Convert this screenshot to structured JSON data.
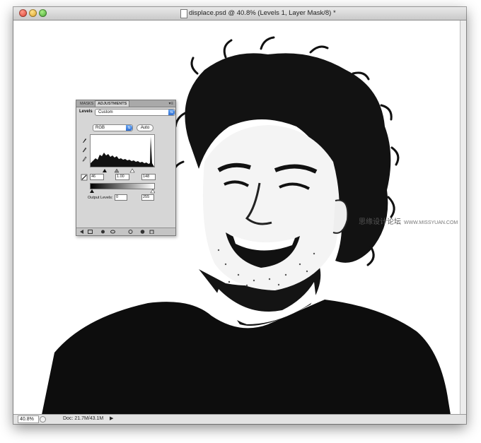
{
  "window": {
    "title": "displace.psd @ 40.8% (Levels 1, Layer Mask/8) *"
  },
  "status_bar": {
    "zoom": "40.8%",
    "doc_size": "Doc: 21.7M/43.1M",
    "arrow": "▶"
  },
  "adjustments_panel": {
    "tabs": [
      "MASKS",
      "ADJUSTMENTS"
    ],
    "menu_glyph": "▾≡",
    "levels_label": "Levels",
    "preset_value": "Custom",
    "channel_value": "RGB",
    "auto_label": "Auto",
    "input_black": "46",
    "input_mid": "1.00",
    "input_white": "148",
    "output_label": "Output Levels:",
    "output_black": "0",
    "output_white": "255"
  },
  "watermark": {
    "text": "思缘设计论坛",
    "url": "WWW.MISSYUAN.COM"
  },
  "colors": {
    "accent_select": "#2f6fd3",
    "close": "#d8372a",
    "minimize": "#d79a1d",
    "maximize": "#3d9d2a"
  },
  "icons": [
    "close-icon",
    "minimize-icon",
    "maximize-icon",
    "document-icon",
    "eyedropper-black-icon",
    "eyedropper-gray-icon",
    "eyedropper-white-icon",
    "clipping-icon",
    "back-icon",
    "new-layer-icon",
    "visibility-icon",
    "view-previous-icon",
    "reset-icon",
    "delete-icon"
  ]
}
